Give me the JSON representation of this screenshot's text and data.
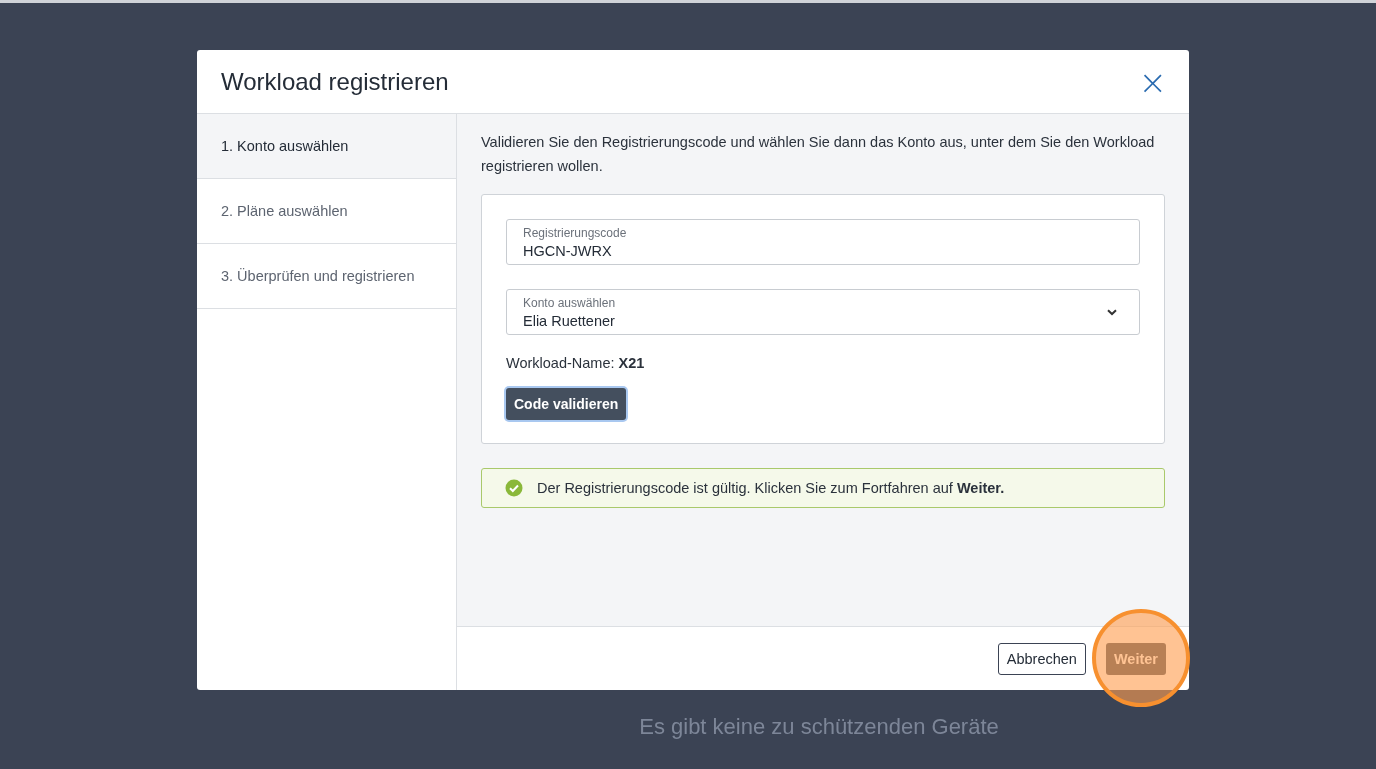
{
  "dialog": {
    "title": "Workload registrieren",
    "close": "×"
  },
  "steps": [
    {
      "label": "1. Konto auswählen",
      "selected": true
    },
    {
      "label": "2. Pläne auswählen",
      "selected": false
    },
    {
      "label": "3. Überprüfen und registrieren",
      "selected": false
    }
  ],
  "intro": "Validieren Sie den Registrierungscode und wählen Sie dann das Konto aus, unter dem Sie den Workload registrieren wollen.",
  "code_field": {
    "label": "Registrierungscode",
    "value": "HGCN-JWRX"
  },
  "account_select": {
    "label": "Konto auswählen",
    "value": "Elia Ruettener"
  },
  "workload_name": "Workload-Name: **X21**",
  "validate_button": "Code validieren",
  "success_message": "Der Registrierungscode ist gültig. Klicken Sie zum Fortfahren auf **Weiter.**",
  "buttons": [
    {
      "label": "Abbrechen",
      "kind": "secondary"
    },
    {
      "label": "Weiter",
      "kind": "primary",
      "highlighted": true
    }
  ],
  "background_message": "Es gibt keine zu schützenden Geräte"
}
